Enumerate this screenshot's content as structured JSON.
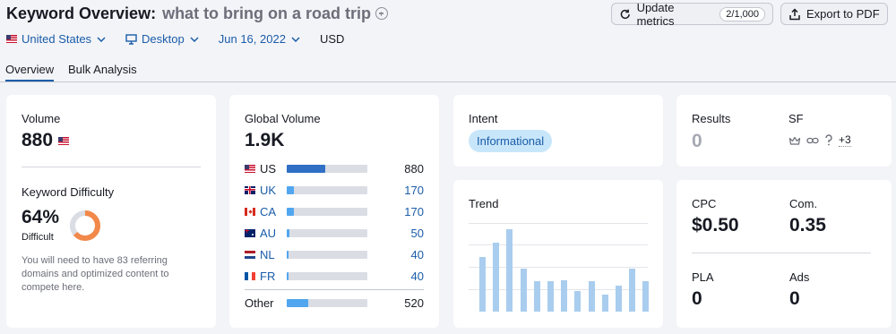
{
  "header": {
    "title": "Keyword Overview:",
    "keyword": "what to bring on a road trip",
    "update_button": "Update metrics",
    "update_counter": "2/1,000",
    "export_button": "Export to PDF"
  },
  "filters": {
    "country": "United States",
    "device": "Desktop",
    "date": "Jun 16, 2022",
    "currency": "USD"
  },
  "tabs": [
    "Overview",
    "Bulk Analysis"
  ],
  "volume": {
    "label": "Volume",
    "value": "880"
  },
  "difficulty": {
    "label": "Keyword Difficulty",
    "percent": "64%",
    "percent_value": 64,
    "level": "Difficult",
    "note": "You will need to have 83 referring domains and optimized content to compete here."
  },
  "global_volume": {
    "label": "Global Volume",
    "value": "1.9K",
    "rows": [
      {
        "code": "US",
        "value": "880",
        "share": 0.48
      },
      {
        "code": "UK",
        "value": "170",
        "share": 0.09
      },
      {
        "code": "CA",
        "value": "170",
        "share": 0.09
      },
      {
        "code": "AU",
        "value": "50",
        "share": 0.03
      },
      {
        "code": "NL",
        "value": "40",
        "share": 0.02
      },
      {
        "code": "FR",
        "value": "40",
        "share": 0.02
      }
    ],
    "other": {
      "label": "Other",
      "value": "520",
      "share": 0.27
    }
  },
  "intent": {
    "label": "Intent",
    "value": "Informational"
  },
  "trend": {
    "label": "Trend",
    "values": [
      0.62,
      0.78,
      0.93,
      0.49,
      0.34,
      0.34,
      0.35,
      0.23,
      0.34,
      0.19,
      0.29,
      0.48,
      0.34
    ]
  },
  "results": {
    "label": "Results",
    "value": "0",
    "sf_label": "SF",
    "sf_more": "+3"
  },
  "metrics": {
    "cpc_label": "CPC",
    "cpc_value": "$0.50",
    "com_label": "Com.",
    "com_value": "0.35",
    "pla_label": "PLA",
    "pla_value": "0",
    "ads_label": "Ads",
    "ads_value": "0"
  },
  "colors": {
    "accent": "#1a5ca8",
    "difficulty_ring": "#f2894a",
    "bar_fill": "#51a6ef",
    "trend_bar": "#a9cdee",
    "badge_bg": "#c8e6fa"
  }
}
